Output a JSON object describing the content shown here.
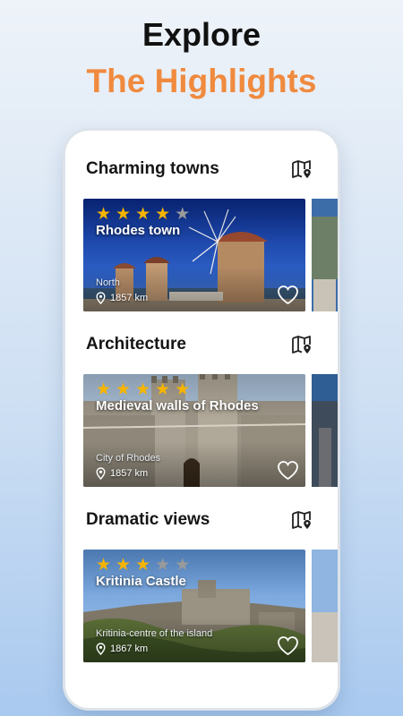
{
  "headline": {
    "line1": "Explore",
    "line2": "The Highlights",
    "accent_color": "#f08a3e"
  },
  "sections": [
    {
      "title": "Charming towns",
      "card": {
        "title": "Rhodes town",
        "rating": 4,
        "max_rating": 5,
        "region": "North",
        "distance": "1857 km"
      }
    },
    {
      "title": "Architecture",
      "card": {
        "title": "Medieval walls of Rhodes",
        "rating": 5,
        "max_rating": 5,
        "region": "City of Rhodes",
        "distance": "1857 km"
      }
    },
    {
      "title": "Dramatic views",
      "card": {
        "title": "Kritinia Castle",
        "rating": 3,
        "max_rating": 5,
        "region": "Kritinia-centre of the island",
        "distance": "1867 km"
      }
    }
  ],
  "icons": {
    "map": "map-icon",
    "pin": "location-pin-icon",
    "favorite": "heart-outline-icon"
  },
  "colors": {
    "star_on": "#f6b400",
    "star_off": "#9a9a9a"
  }
}
